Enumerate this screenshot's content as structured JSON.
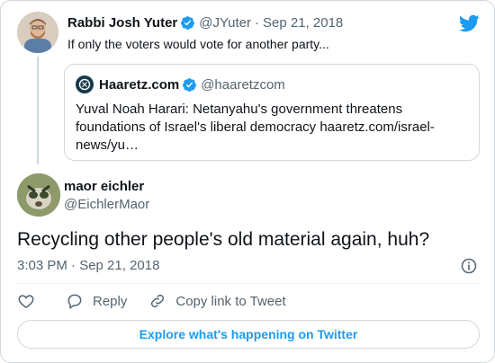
{
  "parent_tweet": {
    "name": "Rabbi Josh Yuter",
    "handle": "@JYuter",
    "separator": "·",
    "date": "Sep 21, 2018",
    "text": "If only the voters would vote for another party..."
  },
  "quoted_tweet": {
    "name": "Haaretz.com",
    "handle": "@haaretzcom",
    "text": "Yuval Noah Harari: Netanyahu's government threatens foundations of Israel's liberal democracy haaretz.com/israel-news/yu…"
  },
  "main_tweet": {
    "name": "maor eichler",
    "handle": "@EichlerMaor",
    "text": "Recycling other people's old material again, huh?",
    "timestamp": "3:03 PM · Sep 21, 2018"
  },
  "actions": {
    "reply": "Reply",
    "copy_link": "Copy link to Tweet"
  },
  "explore_label": "Explore what's happening on Twitter",
  "colors": {
    "accent": "#1d9bf0",
    "text": "#0f1419",
    "muted": "#536471",
    "border": "#cfd9de"
  },
  "icons": [
    "twitter-bird-icon",
    "verified-badge-icon",
    "info-icon",
    "heart-icon",
    "reply-icon",
    "link-icon"
  ]
}
